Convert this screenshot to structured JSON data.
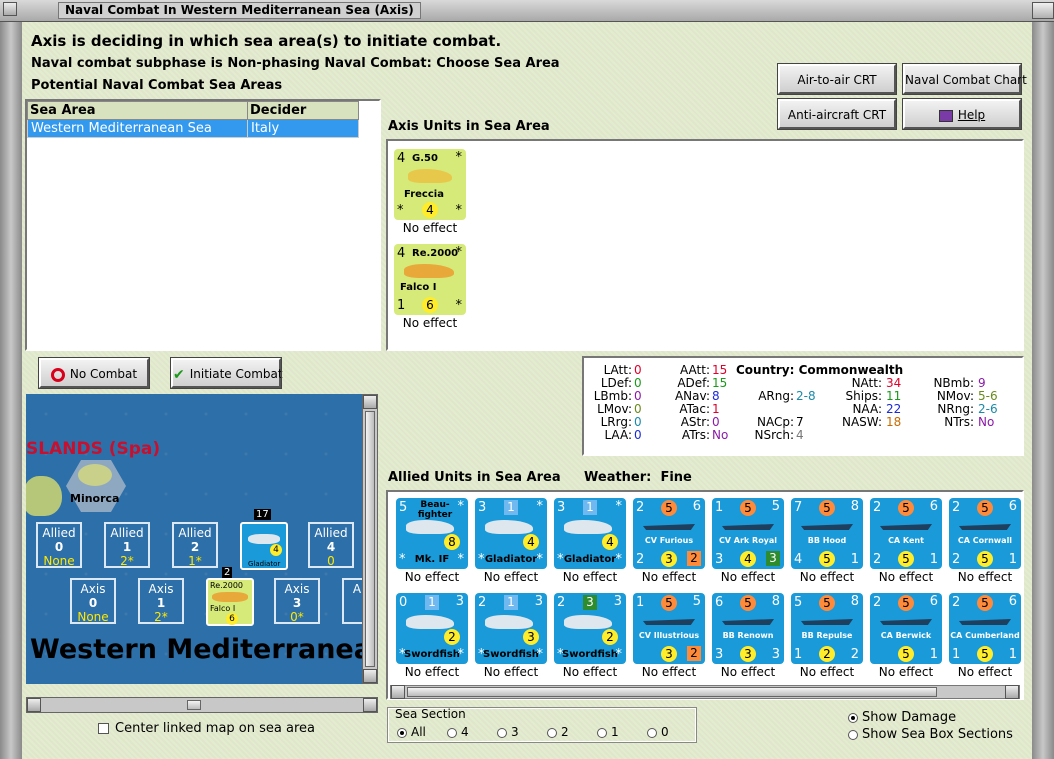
{
  "window": {
    "title": "Naval Combat In Western Mediterranean Sea (Axis)"
  },
  "header": {
    "line1": "Axis is deciding in which sea area(s) to initiate combat.",
    "line2": "Naval combat subphase is Non-phasing Naval Combat: Choose Sea Area",
    "line3": "Potential Naval Combat Sea Areas"
  },
  "buttons": {
    "air_to_air": "Air-to-air CRT",
    "naval_chart": "Naval Combat Chart",
    "anti_aircraft": "Anti-aircraft CRT",
    "help": "Help",
    "no_combat": "No Combat",
    "initiate_combat": "Initiate Combat"
  },
  "sea_table": {
    "col1": "Sea Area",
    "col2": "Decider",
    "rows": [
      {
        "area": "Western Mediterranean Sea",
        "decider": "Italy"
      }
    ]
  },
  "axis_units": {
    "title": "Axis Units in Sea Area",
    "units": [
      {
        "tl": "4",
        "name": "G.50",
        "sub": "Freccia",
        "bl": "*",
        "mid": "4",
        "br": "*",
        "effect": "No effect"
      },
      {
        "tl": "4",
        "name": "Re.2000",
        "sub": "Falco I",
        "bl": "1",
        "mid": "6",
        "br": "*",
        "effect": "No effect"
      }
    ]
  },
  "stats": {
    "country_label": "Country:",
    "country": "Commonwealth",
    "latt": "LAtt:",
    "latt_v": "0",
    "ldef": "LDef:",
    "ldef_v": "0",
    "lbmb": "LBmb:",
    "lbmb_v": "0",
    "lmov": "LMov:",
    "lmov_v": "0",
    "lrg": "LRrg:",
    "lrg_v": "0",
    "laa": "LAA:",
    "laa_v": "0",
    "aatt": "AAtt:",
    "aatt_v": "15",
    "adef": "ADef:",
    "adef_v": "15",
    "anav": "ANav:",
    "anav_v": "8",
    "atac": "ATac:",
    "atac_v": "1",
    "astr": "AStr:",
    "astr_v": "0",
    "atrs": "ATrs:",
    "atrs_v": "No",
    "arng": "ARng:",
    "arng_v": "2-8",
    "nacp": "NACp:",
    "nacp_v": "7",
    "nsrch": "NSrch:",
    "nsrch_v": "4",
    "natt": "NAtt:",
    "natt_v": "34",
    "ships": "Ships:",
    "ships_v": "11",
    "naa": "NAA:",
    "naa_v": "22",
    "nasw": "NASW:",
    "nasw_v": "18",
    "nbmb": "NBmb:",
    "nbmb_v": "9",
    "nmov": "NMov:",
    "nmov_v": "5-6",
    "nrng": "NRng:",
    "nrng_v": "2-6",
    "ntrs": "NTrs:",
    "ntrs_v": "No"
  },
  "allied": {
    "title": "Allied Units in Sea Area",
    "weather_label": "Weather:",
    "weather": "Fine",
    "row1": [
      {
        "tl": "5",
        "name": "Beau-fighter",
        "sub": "Mk. IF",
        "mid": "8",
        "effect": "No effect"
      },
      {
        "tl": "3",
        "sq": "1",
        "sub": "Gladiator",
        "mid": "4",
        "effect": "No effect"
      },
      {
        "tl": "3",
        "sq": "1",
        "sub": "Gladiator",
        "mid": "4",
        "effect": "No effect"
      },
      {
        "tl": "2",
        "oc": "5",
        "tr": "6",
        "sub": "CV Furious",
        "bl": "2",
        "mid": "3",
        "sq2": "2",
        "effect": "No effect"
      },
      {
        "tl": "1",
        "oc": "5",
        "tr": "5",
        "sub": "CV Ark Royal",
        "bl": "3",
        "mid": "4",
        "sq2": "3",
        "effect": "No effect"
      },
      {
        "tl": "7",
        "oc": "5",
        "tr": "8",
        "sub": "BB Hood",
        "bl": "4",
        "mid": "5",
        "br": "1",
        "effect": "No effect"
      },
      {
        "tl": "2",
        "oc": "5",
        "tr": "6",
        "sub": "CA Kent",
        "bl": "2",
        "mid": "5",
        "br": "1",
        "effect": "No effect"
      },
      {
        "tl": "2",
        "oc": "5",
        "tr": "6",
        "sub": "CA Cornwall",
        "bl": "2",
        "mid": "5",
        "br": "1",
        "effect": "No effect"
      }
    ],
    "row2": [
      {
        "tl": "0",
        "sq": "1",
        "tr": "3",
        "sub": "Swordfish",
        "mid": "2",
        "effect": "No effect"
      },
      {
        "tl": "2",
        "sq": "1",
        "tr": "3",
        "sub": "Swordfish",
        "mid": "3",
        "effect": "No effect"
      },
      {
        "tl": "2",
        "sq": "3",
        "tr": "3",
        "sub": "Swordfish",
        "mid": "2",
        "effect": "No effect"
      },
      {
        "tl": "1",
        "oc": "5",
        "tr": "5",
        "sub": "CV Illustrious",
        "mid": "3",
        "sq2": "2",
        "effect": "No effect"
      },
      {
        "tl": "6",
        "oc": "5",
        "tr": "8",
        "sub": "BB Renown",
        "bl": "3",
        "mid": "3",
        "br": "3",
        "effect": "No effect"
      },
      {
        "tl": "5",
        "oc": "5",
        "tr": "8",
        "sub": "BB Repulse",
        "bl": "1",
        "mid": "2",
        "br": "2",
        "effect": "No effect"
      },
      {
        "tl": "2",
        "oc": "5",
        "tr": "6",
        "sub": "CA Berwick",
        "mid": "5",
        "br": "1",
        "effect": "No effect"
      },
      {
        "tl": "2",
        "oc": "5",
        "tr": "6",
        "sub": "CA Cumberland",
        "bl": "1",
        "mid": "5",
        "br": "1",
        "effect": "No effect"
      }
    ]
  },
  "map": {
    "region_label": "SLANDS (Spa)",
    "island": "Minorca",
    "sea_label": "Western Mediterranea",
    "allied_boxes": [
      {
        "label": "Allied",
        "num": "0",
        "sub": "None"
      },
      {
        "label": "Allied",
        "num": "1",
        "sub": "2*"
      },
      {
        "label": "Allied",
        "num": "2",
        "sub": "1*"
      },
      {
        "label": "Allied",
        "num": "4",
        "sub": "0"
      }
    ],
    "axis_boxes": [
      {
        "label": "Axis",
        "num": "0",
        "sub": "None"
      },
      {
        "label": "Axis",
        "num": "1",
        "sub": "2*"
      },
      {
        "label": "Axis",
        "num": "3",
        "sub": "0*"
      }
    ],
    "stack_allied": "17",
    "stack_axis": "2",
    "gladiator_label": "Gladiator",
    "falco_label": "Falco I",
    "re2000": "Re.2000"
  },
  "bottom": {
    "center_linked": "Center linked map on sea area",
    "sea_section": "Sea Section",
    "options": [
      "All",
      "4",
      "3",
      "2",
      "1",
      "0"
    ],
    "show_damage": "Show Damage",
    "show_sections": "Show Sea Box Sections"
  },
  "colors": {
    "bg": "#e3ebcf",
    "allied_unit": "#1a9ad8",
    "axis_air": "#d6ea7a",
    "sel": "#3399ee"
  }
}
